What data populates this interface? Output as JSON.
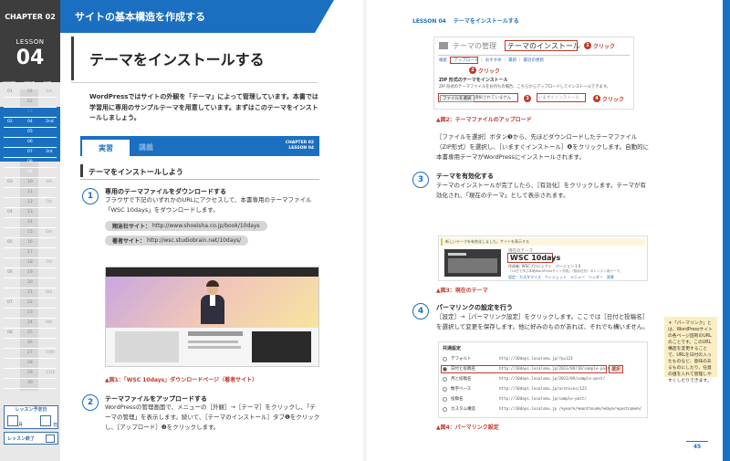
{
  "header": {
    "chapter": "CHAPTER 02",
    "section": "サイトの基本構造を作成する"
  },
  "sidebar": {
    "lesson_word": "LESSON",
    "lesson_number": "04",
    "col_headers": [
      "CHAPTER",
      "LESSON",
      "DATE"
    ],
    "rows": [
      {
        "ch": "01",
        "ls": "01",
        "d": "1st"
      },
      {
        "ch": "",
        "ls": "02",
        "d": ""
      },
      {
        "ch": "",
        "ls": "03",
        "d": ""
      },
      {
        "ch": "02",
        "ls": "04",
        "d": "2nd"
      },
      {
        "ch": "",
        "ls": "05",
        "d": ""
      },
      {
        "ch": "",
        "ls": "06",
        "d": ""
      },
      {
        "ch": "",
        "ls": "07",
        "d": "3rd"
      },
      {
        "ch": "",
        "ls": "08",
        "d": ""
      },
      {
        "ch": "",
        "ls": "09",
        "d": ""
      },
      {
        "ch": "03",
        "ls": "10",
        "d": "4th"
      },
      {
        "ch": "",
        "ls": "11",
        "d": ""
      },
      {
        "ch": "",
        "ls": "12",
        "d": "5th"
      },
      {
        "ch": "04",
        "ls": "13",
        "d": ""
      },
      {
        "ch": "",
        "ls": "14",
        "d": ""
      },
      {
        "ch": "",
        "ls": "15",
        "d": "6th"
      },
      {
        "ch": "05",
        "ls": "16",
        "d": ""
      },
      {
        "ch": "",
        "ls": "17",
        "d": ""
      },
      {
        "ch": "",
        "ls": "18",
        "d": "7th"
      },
      {
        "ch": "06",
        "ls": "19",
        "d": ""
      },
      {
        "ch": "",
        "ls": "20",
        "d": ""
      },
      {
        "ch": "",
        "ls": "21",
        "d": "8th"
      },
      {
        "ch": "07",
        "ls": "22",
        "d": ""
      },
      {
        "ch": "",
        "ls": "23",
        "d": ""
      },
      {
        "ch": "",
        "ls": "24",
        "d": "9th"
      },
      {
        "ch": "08",
        "ls": "25",
        "d": ""
      },
      {
        "ch": "",
        "ls": "26",
        "d": ""
      },
      {
        "ch": "",
        "ls": "27",
        "d": "10th"
      },
      {
        "ch": "",
        "ls": "28",
        "d": ""
      },
      {
        "ch": "",
        "ls": "29",
        "d": "11th"
      },
      {
        "ch": "",
        "ls": "30",
        "d": ""
      }
    ],
    "plan_label": "レッスン予定日",
    "plan_month": "月",
    "plan_day": "日",
    "done_label": "レッスン終了"
  },
  "left_page": {
    "title": "テーマをインストールする",
    "intro": "WordPressではサイトの外観を「テーマ」によって管理しています。本書では学習用に専用のサンプルテーマを用意しています。まずはこのテーマをインストールしましょう。",
    "tab_active": "実習",
    "tab_inactive": "講義",
    "tab_chapter": "CHAPTER 02",
    "tab_lesson": "LESSON 04",
    "sub_heading": "テーマをインストールしよう",
    "step1": {
      "num": "1",
      "title": "専用のテーマファイルをダウンロードする",
      "body": "ブラウザで下記のいずれかのURLにアクセスして、本書専用のテーマファイル「WSC 10days」をダウンロードします。"
    },
    "url1": {
      "label": "翔泳社サイト：",
      "url": "http://www.shoeisha.co.jp/book/10days"
    },
    "url2": {
      "label": "著者サイト：",
      "url": "http://wsc.studiobrain.net/10days/"
    },
    "fig1_caption": "▲図1：「WSC 10days」ダウンロードページ（著者サイト）",
    "step2": {
      "num": "2",
      "title": "テーマファイルをアップロードする",
      "body": "WordPressの管理画面で、メニューの［外観］→［テーマ］をクリックし、「テーマの管理」を表示します。続いて、［テーマのインストール］タブ❶をクリックし、［アップロード］❷をクリックします。"
    }
  },
  "right_page": {
    "lesson": "LESSON 04",
    "title": "テーマをインストールする",
    "fig2": {
      "tab_manage": "テーマの管理",
      "tab_install": "テーマのインストール",
      "links": "検索 ｜ アップロード ｜ おすすめ ｜ 最新 ｜ 最近の更新",
      "zip_heading": "ZIP 形式のテーマをインストール",
      "zip_desc": "ZIP 形式のテーマファイルをお持ちの場合、こちらからアップロードしてインストールできます。",
      "file_btn": "ファイルを選択",
      "file_none": "選択されていません",
      "install_btn": "いますぐインストール",
      "click": "クリック"
    },
    "fig2_caption": "▲図2：テーマファイルのアップロード",
    "para2": "［ファイルを選択］ボタン❸から、先ほどダウンロードしたテーマファイル（ZIP形式）を選択し、［いますぐインストール］❹をクリックします。自動的に本書専用テーマがWordPressにインストールされます。",
    "step3": {
      "num": "3",
      "title": "テーマを有効化する",
      "body": "テーマのインストールが完了したら、［有効化］をクリックします。テーマが有効化され、「現在のテーマ」として表示されます。"
    },
    "fig3": {
      "notice": "新しいテーマを有効化しました。サイトを表示する",
      "current": "現在のテーマ",
      "theme_name": "WSC 10days",
      "author": "作成者: WSCプロジェクト　バージョン 1.0",
      "desc": "「10日で学ぶ本格WordPressサイト作成」（翔泳社刊）のレッスン用テーマ。",
      "options": "設定：カスタマイズ　ウィジェット　メニュー　ヘッダー　背景"
    },
    "fig3_caption": "▲図3：現在のテーマ",
    "step4": {
      "num": "4",
      "title": "パーマリンクの設定を行う",
      "body": "［設定］→［パーマリンク設定］をクリックします。ここでは［日付と投稿名］を選択して変更を保存します。他に好みのものがあれば、それでも構いません。"
    },
    "fig4": {
      "heading": "共通設定",
      "select": "選択",
      "rows": [
        {
          "label": "デフォルト",
          "url": "http://10days.localsmu.jp/?p=123"
        },
        {
          "label": "日付と投稿名",
          "url": "http://10days.localsmu.jp/2013/09/18/sample-post/"
        },
        {
          "label": "月と投稿名",
          "url": "http://10days.localsmu.jp/2013/09/sample-post/"
        },
        {
          "label": "数字ベース",
          "url": "http://10days.localsmu.jp/archives/123"
        },
        {
          "label": "投稿名",
          "url": "http://10days.localsmu.jp/sample-post/"
        },
        {
          "label": "カスタム構造",
          "url": "http://10days.localsmu.jp /%year%/%monthnum%/%day%/%postname%/"
        }
      ]
    },
    "fig4_caption": "▲図4：パーマリンク設定",
    "note": "＊「パーマリンク」とは、WordPressサイトの各ページ固有のURLのことです。このURL構造を変更することで、URLを日付の入ったものなど、意味のあるものにしたり、任意の値を入れて管理しやすくしたりできます。",
    "page_number": "45"
  },
  "colors": {
    "accent": "#1a6fc0",
    "dark": "#3d3d3d",
    "alert": "#c0392b",
    "note_bg": "#fbeec2"
  }
}
